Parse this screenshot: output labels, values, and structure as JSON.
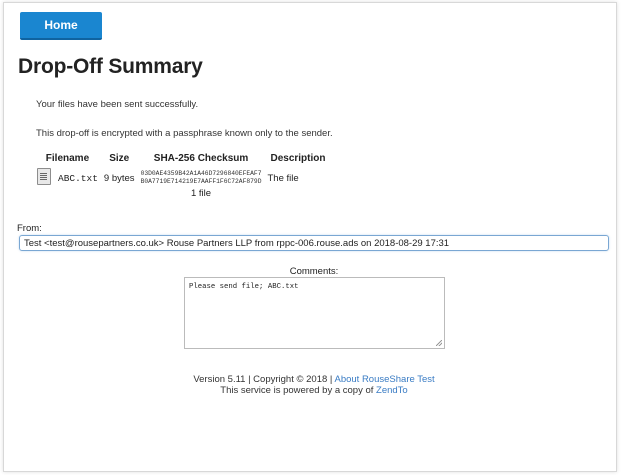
{
  "nav": {
    "home_label": "Home"
  },
  "page": {
    "title": "Drop-Off Summary",
    "success_message": "Your files have been sent successfully.",
    "encryption_message": "This drop-off is encrypted with a passphrase known only to the sender."
  },
  "files_table": {
    "headers": [
      "Filename",
      "Size",
      "SHA-256 Checksum",
      "Description"
    ],
    "rows": [
      {
        "icon": "file-icon",
        "filename": "ABC.txt",
        "size": "9 bytes",
        "checksum_line1": "03D0AE4359B42A1A46D7296840EFEAF7",
        "checksum_line2": "B0A7719E714219E7AAFF1F6C72AF879D",
        "description": "The file"
      }
    ],
    "file_count": "1 file"
  },
  "from": {
    "label": "From:",
    "value": "Test  <test@rousepartners.co.uk>  Rouse Partners LLP  from rppc-006.rouse.ads on 2018-08-29 17:31"
  },
  "comments": {
    "label": "Comments:",
    "value": "Please send file; ABC.txt"
  },
  "footer": {
    "version_text": "Version 5.11 | Copyright © 2018 | ",
    "about_link": "About RouseShare Test",
    "powered_text": "This service is powered by a copy of ",
    "zendto_link": "ZendTo"
  },
  "colors": {
    "accent": "#1a86d0",
    "link": "#3a7cc4"
  }
}
